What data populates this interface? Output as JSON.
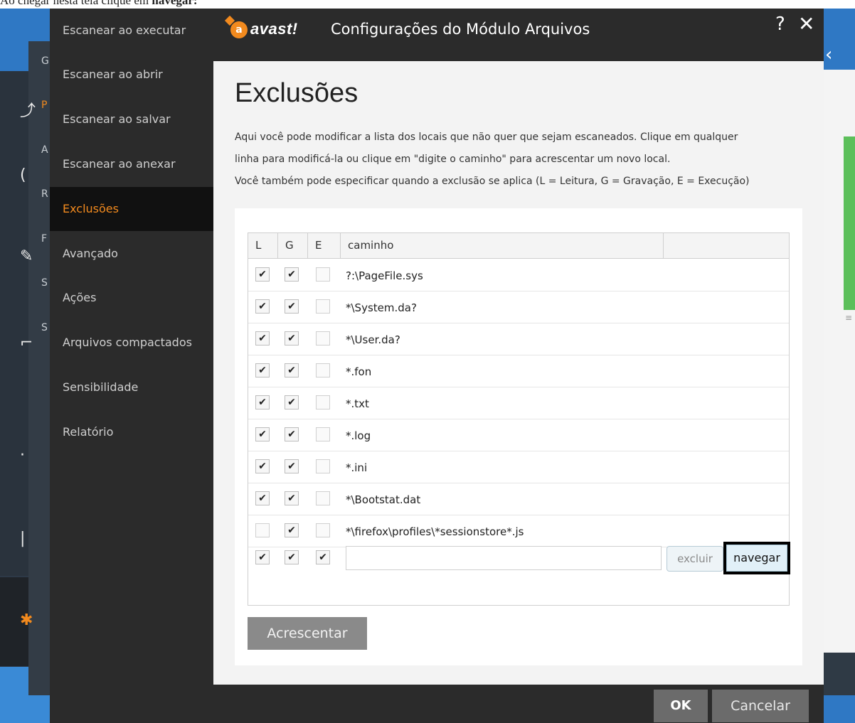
{
  "instruction": {
    "prefix": "Ao chegar nesta tela clique em ",
    "emphasis": "navegar:"
  },
  "dialog": {
    "logo_text": "avast!",
    "title": "Configurações do Módulo Arquivos",
    "help": "?",
    "close": "✕"
  },
  "nav": {
    "items": [
      {
        "label": "Escanear ao executar"
      },
      {
        "label": "Escanear ao abrir"
      },
      {
        "label": "Escanear ao salvar"
      },
      {
        "label": "Escanear ao anexar"
      },
      {
        "label": "Exclusões"
      },
      {
        "label": "Avançado"
      },
      {
        "label": "Ações"
      },
      {
        "label": "Arquivos compactados"
      },
      {
        "label": "Sensibilidade"
      },
      {
        "label": "Relatório"
      }
    ]
  },
  "content": {
    "title": "Exclusões",
    "desc1": "Aqui você pode modificar a lista dos locais que não quer que sejam escaneados. Clique em qualquer",
    "desc2": "linha para modificá-la ou clique em \"digite o caminho\" para acrescentar um novo local.",
    "desc3": "Você também pode especificar quando a exclusão se aplica (L = Leitura, G = Gravação, E = Execução)"
  },
  "table": {
    "headers": {
      "l": "L",
      "g": "G",
      "e": "E",
      "path": "caminho"
    },
    "rows": [
      {
        "l": true,
        "g": true,
        "e": false,
        "path": "?:\\PageFile.sys"
      },
      {
        "l": true,
        "g": true,
        "e": false,
        "path": "*\\System.da?"
      },
      {
        "l": true,
        "g": true,
        "e": false,
        "path": "*\\User.da?"
      },
      {
        "l": true,
        "g": true,
        "e": false,
        "path": "*.fon"
      },
      {
        "l": true,
        "g": true,
        "e": false,
        "path": "*.txt"
      },
      {
        "l": true,
        "g": true,
        "e": false,
        "path": "*.log"
      },
      {
        "l": true,
        "g": true,
        "e": false,
        "path": "*.ini"
      },
      {
        "l": true,
        "g": true,
        "e": false,
        "path": "*\\Bootstat.dat"
      },
      {
        "l": false,
        "g": true,
        "e": false,
        "path": "*\\firefox\\profiles\\*sessionstore*.js"
      }
    ],
    "new_row": {
      "l": true,
      "g": true,
      "e": true,
      "value": "",
      "excluir": "excluir",
      "navegar": "navegar"
    }
  },
  "buttons": {
    "add": "Acrescentar",
    "ok": "OK",
    "cancel": "Cancelar"
  },
  "background": {
    "letters": [
      "G",
      "P",
      "A",
      "R",
      "F",
      "S",
      "S"
    ]
  },
  "colors": {
    "accent": "#f28a1e",
    "dialog_bg": "#2b2b2b",
    "content_bg": "#f3f3f3"
  }
}
